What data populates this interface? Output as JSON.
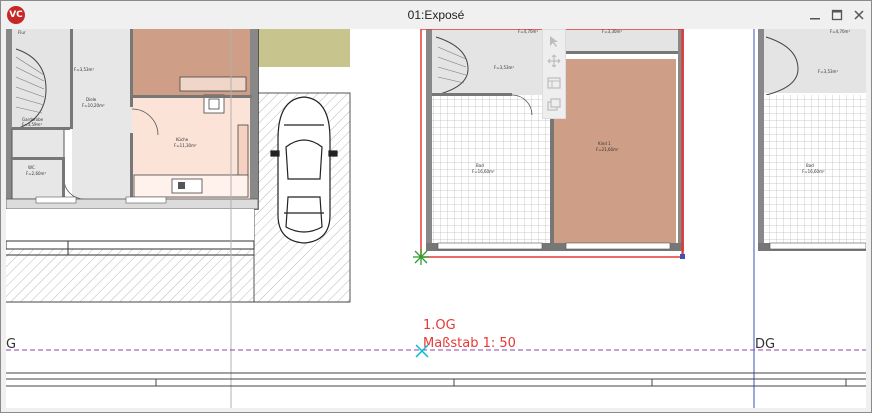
{
  "window": {
    "title": "01:Exposé",
    "logo_text": "VC",
    "accent": "#c62828"
  },
  "controls": {
    "minimize_icon": "minimize-icon",
    "maximize_icon": "maximize-icon",
    "close_icon": "close-icon"
  },
  "drawing": {
    "floor_label": "1.OG",
    "scale_label": "Maßstab 1: 50",
    "left_floor_label": "G",
    "right_floor_label": "DG",
    "annotation_color": "#e53935",
    "selection_color": "#e53935",
    "accent_line_color": "#3f51b5",
    "rooms": {
      "flur": "Flur",
      "flur_area": "F=4,70m²",
      "diele": "Diele",
      "diele_area": "F=10,20m²",
      "garderobe": "Garderobe",
      "garderobe_area": "F=3,59m²",
      "wc": "WC",
      "wc_area": "F=2,60m²",
      "kueche": "Küche",
      "kueche_area": "F=11,30m²",
      "bad": "Bad",
      "bad_area": "F=16,60m²",
      "kind": "Kind 1",
      "kind_area": "F=21,60m²",
      "top_area": "F=3,30m²",
      "stair_area": "F=3,53m²",
      "right_flur_area": "F=4,70m²",
      "right_bad": "Bad",
      "right_bad_area": "F=16,60m²"
    }
  },
  "mini_toolbar": {
    "items": [
      "cursor-icon",
      "move-icon",
      "layout-icon",
      "copy-icon"
    ]
  }
}
